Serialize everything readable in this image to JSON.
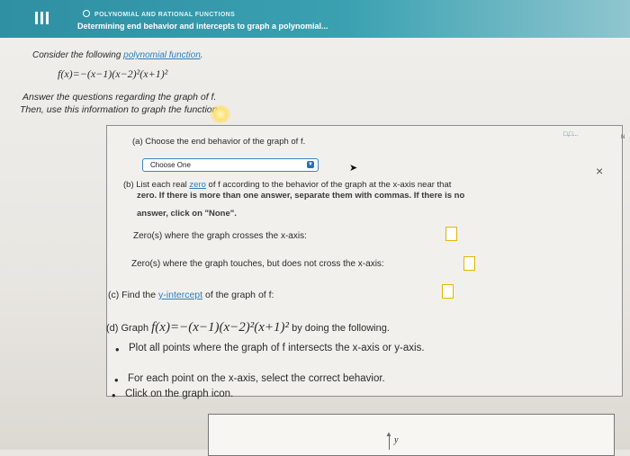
{
  "header": {
    "topic": "POLYNOMIAL AND RATIONAL FUNCTIONS",
    "subtitle": "Determining end behavior and intercepts to graph a polynomial..."
  },
  "intro": {
    "consider_prefix": "Consider the following ",
    "consider_link": "polynomial function",
    "consider_suffix": ".",
    "function": "f(x)=−(x−1)(x−2)²(x+1)²",
    "answer_line": "Answer the questions regarding the graph of f.",
    "then_line": "Then, use this information to graph the function."
  },
  "part_a": {
    "label": "(a) Choose the end behavior of the graph of f.",
    "dropdown_value": "Choose One"
  },
  "part_b": {
    "line1_prefix": "(b) List each real ",
    "line1_link": "zero",
    "line1_suffix": " of f according to the behavior of the graph at the x-axis near that",
    "line2": "zero. If there is more than one answer, separate them with commas. If there is no",
    "line3": "answer, click on \"None\".",
    "crosses_label": "Zero(s) where the graph crosses the x-axis:",
    "touches_label": "Zero(s) where the graph touches, but does not cross the x-axis:"
  },
  "part_c": {
    "prefix": "(c) Find the ",
    "link": "y-intercept",
    "suffix": " of the graph of f:"
  },
  "part_d": {
    "prefix": "(d) Graph ",
    "function": "f(x)=−(x−1)(x−2)²(x+1)²",
    "suffix": " by doing the following.",
    "bullets": [
      "Plot all points where the graph of f intersects the x-axis or y-axis.",
      "For each point on the x-axis, select the correct behavior.",
      "Click on the graph icon."
    ]
  },
  "toolbar": {
    "tools_label": "□,□...",
    "close_label": "×",
    "edge_label": "N"
  },
  "graph": {
    "y_label": "y"
  },
  "icons": [
    "menu-icon",
    "chevron-down-icon",
    "dropdown-arrow-icon",
    "cursor-icon",
    "close-icon"
  ]
}
